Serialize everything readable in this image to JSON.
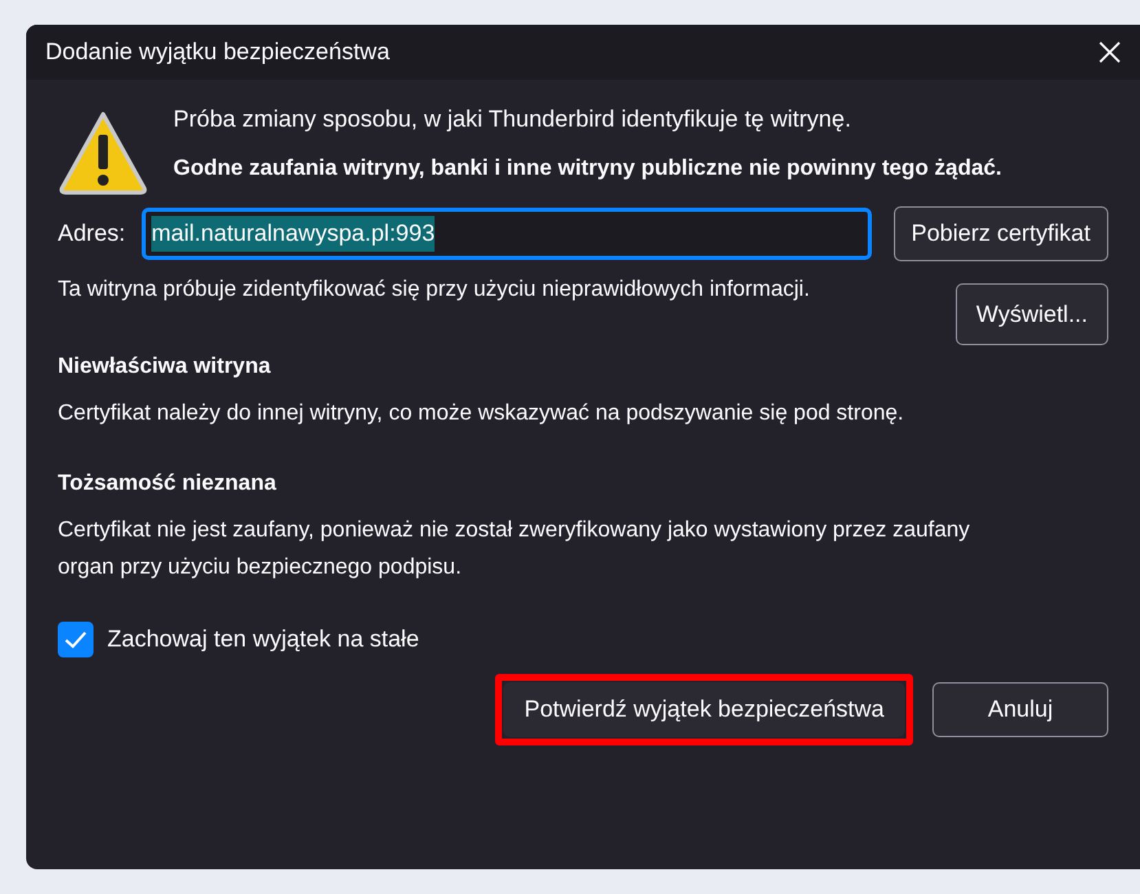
{
  "window": {
    "title": "Dodanie wyjątku bezpieczeństwa"
  },
  "warning": {
    "text": "Próba zmiany sposobu, w jaki Thunderbird identyfikuje tę witrynę.",
    "bold_text": "Godne zaufania witryny, banki i inne witryny publiczne nie powinny tego żądać."
  },
  "address": {
    "label": "Adres:",
    "value": "mail.naturalnawyspa.pl:993",
    "button": "Pobierz certyfikat"
  },
  "status": {
    "text": "Ta witryna próbuje zidentyfikować się przy użyciu nieprawidłowych informacji.",
    "button": "Wyświetl..."
  },
  "problems": [
    {
      "title": "Niewłaściwa witryna",
      "text": "Certyfikat należy do innej witryny, co może wskazywać na podszywanie się pod stronę."
    },
    {
      "title": "Tożsamość nieznana",
      "text": "Certyfikat nie jest zaufany, ponieważ nie został zweryfikowany jako wystawiony przez zaufany organ przy użyciu bezpiecznego podpisu."
    }
  ],
  "permanent": {
    "label": "Zachowaj ten wyjątek na stałe",
    "checked": true
  },
  "buttons": [
    {
      "label": "Potwierdź wyjątek bezpieczeństwa",
      "highlighted": true
    },
    {
      "label": "Anuluj",
      "highlighted": false
    }
  ]
}
